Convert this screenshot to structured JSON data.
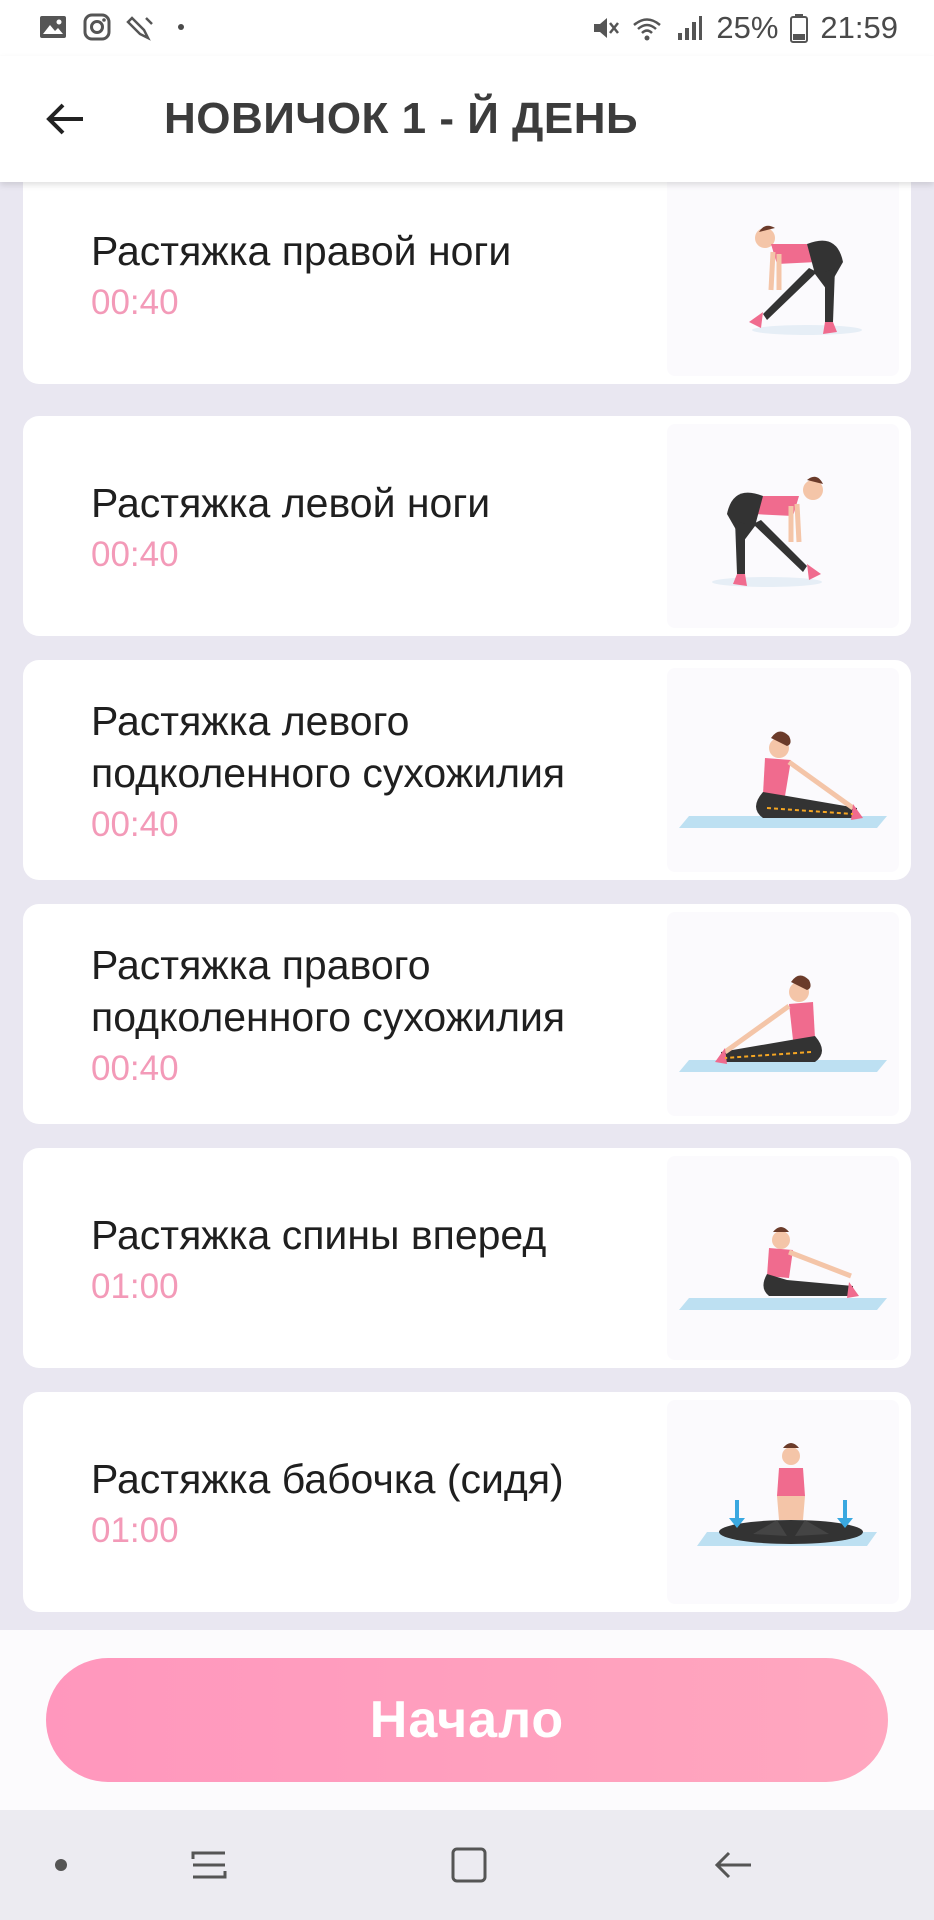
{
  "status_bar": {
    "battery": "25%",
    "time": "21:59",
    "left_icons": [
      "gallery-icon",
      "instagram-icon",
      "pen-icon"
    ],
    "right_icons": [
      "mute-icon",
      "wifi-icon",
      "signal-icon",
      "battery-icon"
    ]
  },
  "app_bar": {
    "title": "НОВИЧОК 1 - Й ДЕНЬ",
    "back_icon": "arrow-left-icon"
  },
  "exercises": [
    {
      "name": "Растяжка правой ноги",
      "time": "00:40",
      "illustration": "standing-right-leg-stretch"
    },
    {
      "name": "Растяжка левой ноги",
      "time": "00:40",
      "illustration": "standing-left-leg-stretch"
    },
    {
      "name": "Растяжка левого подколенного сухожилия",
      "time": "00:40",
      "illustration": "seated-left-hamstring-stretch"
    },
    {
      "name": "Растяжка правого подколенного сухожилия",
      "time": "00:40",
      "illustration": "seated-right-hamstring-stretch"
    },
    {
      "name": "Растяжка спины вперед",
      "time": "01:00",
      "illustration": "seated-forward-bend"
    },
    {
      "name": "Растяжка бабочка (сидя)",
      "time": "01:00",
      "illustration": "butterfly-stretch"
    }
  ],
  "start_button": {
    "label": "Начало"
  },
  "colors": {
    "accent": "#f39ab8",
    "button_start": "#ff97bd",
    "button_end": "#ffa7bf",
    "background": "#e9e7f1"
  },
  "nav_bar": {
    "icons": [
      "dot-icon",
      "recents-icon",
      "home-icon",
      "back-icon"
    ]
  }
}
